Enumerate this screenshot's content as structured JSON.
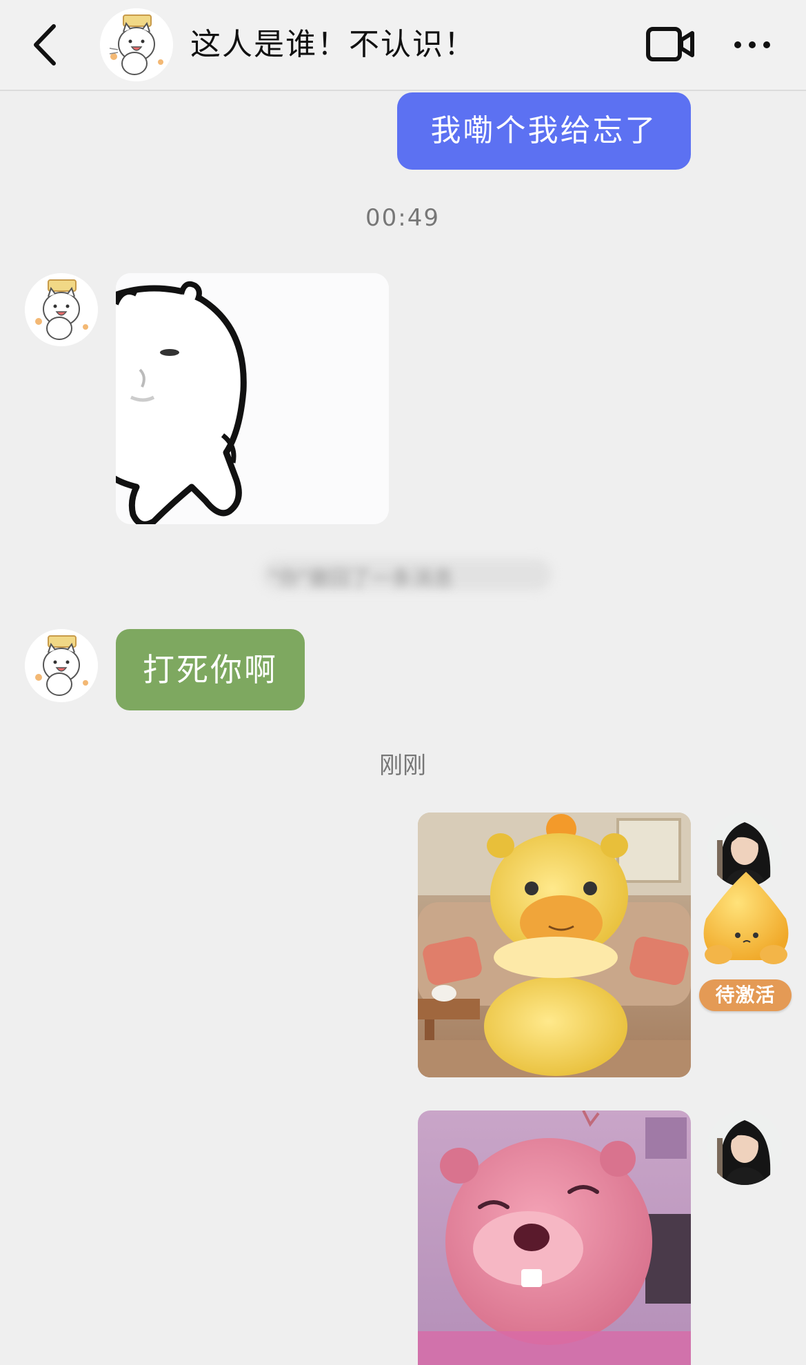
{
  "header": {
    "back_icon": "chevron-left-icon",
    "title": "这人是谁！不认识！",
    "video_icon": "video-camera-icon",
    "more_icon": "more-dots-icon",
    "contact_avatar": "white-cat-avatar"
  },
  "messages": [
    {
      "sender": "me",
      "type": "text",
      "text": "我嘞个我给忘了",
      "color": "#5c71f2"
    },
    {
      "type": "timestamp",
      "text": "00:49"
    },
    {
      "sender": "contact",
      "type": "sticker",
      "content": "white-bear-sticker"
    },
    {
      "type": "recall_notice",
      "text": "\"你\"撤回了一条消息"
    },
    {
      "sender": "contact",
      "type": "text",
      "text": "打死你啊",
      "color": "#7ea860"
    },
    {
      "type": "timestamp",
      "text": "刚刚"
    },
    {
      "sender": "me",
      "type": "image",
      "content": "yellow-capybara-image"
    },
    {
      "sender": "me",
      "type": "image",
      "content": "pink-beaver-image"
    }
  ],
  "side_pet": {
    "badge_text": "待激活",
    "badge_color": "#e49a55"
  }
}
